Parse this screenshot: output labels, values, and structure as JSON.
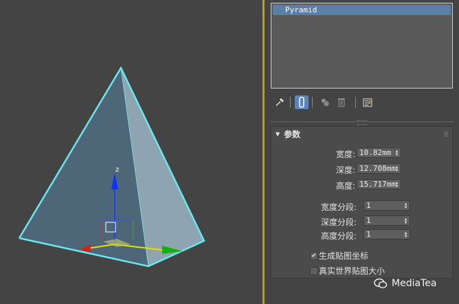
{
  "modifier_stack": {
    "items": [
      "Pyramid"
    ]
  },
  "toolbar": {
    "icons": [
      "pin-stack-icon",
      "show-end-result-icon",
      "make-unique-icon",
      "remove-modifier-icon",
      "configure-sets-icon"
    ]
  },
  "parameters": {
    "title": "参数",
    "width_label": "宽度:",
    "width_value": "10.82mm",
    "depth_label": "深度:",
    "depth_value": "12.708mm",
    "height_label": "高度:",
    "height_value": "15.717mm",
    "width_segs_label": "宽度分段:",
    "width_segs_value": "1",
    "depth_segs_label": "深度分段:",
    "depth_segs_value": "1",
    "height_segs_label": "高度分段:",
    "height_segs_value": "1",
    "gen_mapping_label": "生成贴图坐标",
    "gen_mapping_checked": true,
    "real_world_label": "真实世界贴图大小",
    "real_world_checked": false
  },
  "viewport": {
    "axis_z_label": "z"
  },
  "watermark": {
    "text": "MediaTea"
  }
}
